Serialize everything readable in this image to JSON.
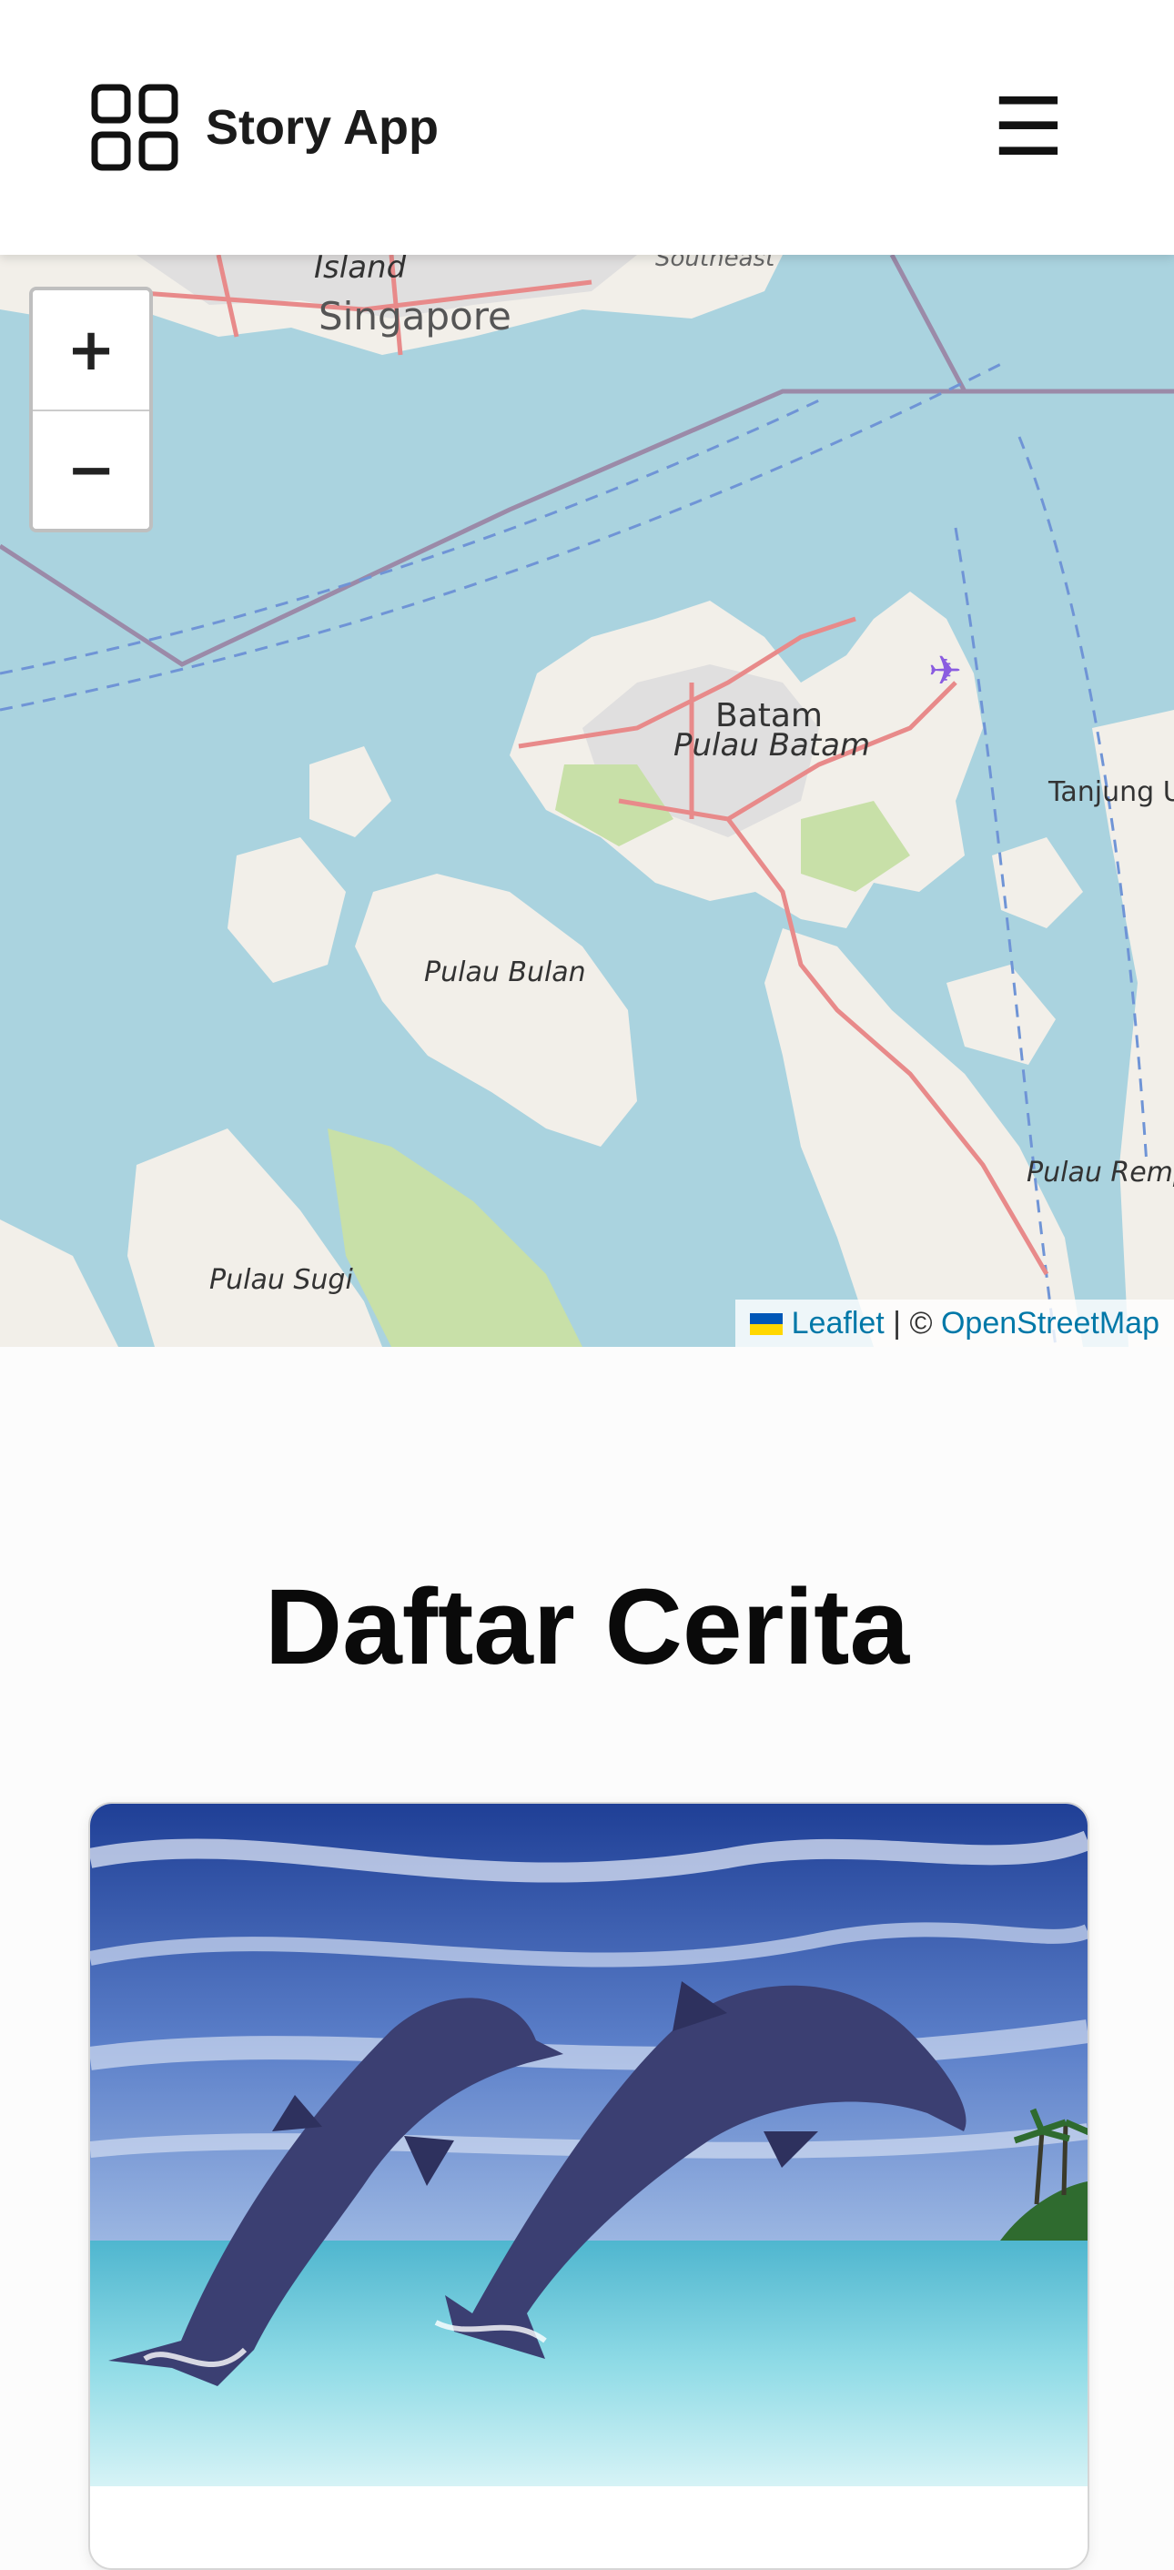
{
  "header": {
    "app_title": "Story App",
    "logo_icon": "grid-icon",
    "menu_glyph": "☰",
    "menu_icon": "hamburger-menu-icon"
  },
  "map": {
    "zoom_in_label": "+",
    "zoom_out_label": "−",
    "labels": {
      "island": "Island",
      "singapore": "Singapore",
      "southeast": "Southeast",
      "batam": "Batam",
      "pulau_batam": "Pulau Batam",
      "tanjung": "Tanjung U",
      "pulau_bulan": "Pulau Bulan",
      "pulau_rempang": "Pulau Remp",
      "pulau_sugi": "Pulau Sugi"
    },
    "attribution": {
      "leaflet": "Leaflet",
      "separator": " | © ",
      "osm": "OpenStreetMap"
    }
  },
  "main": {
    "title": "Daftar Cerita",
    "stories": [
      {
        "image_subject": "two dolphins jumping out of the sea",
        "name": ""
      }
    ]
  },
  "colors": {
    "water": "#aad3df",
    "land": "#f2efe9",
    "park": "#c8e0a8",
    "urban": "#e0dfdf",
    "road": "#f08080",
    "link": "#0078a8"
  }
}
